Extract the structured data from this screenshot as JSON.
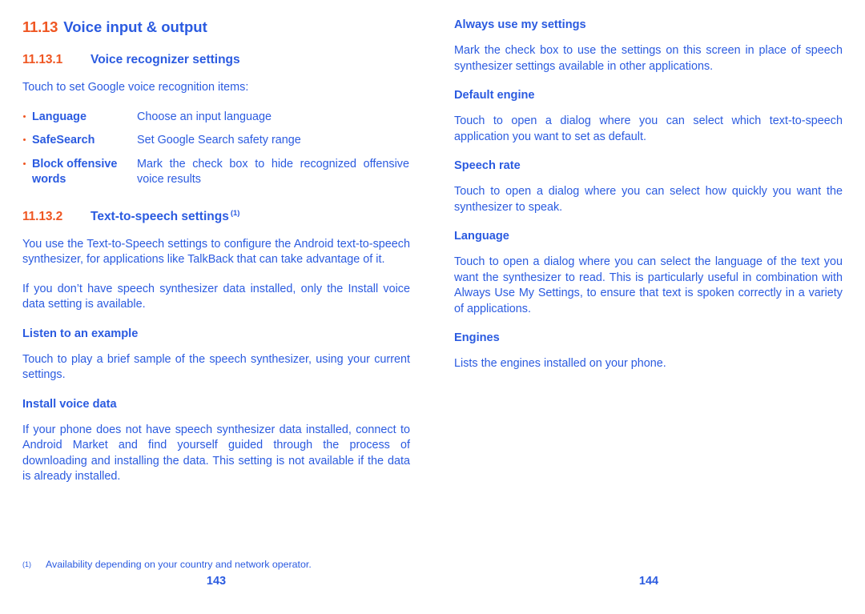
{
  "colors": {
    "accent_orange": "#ef5622",
    "text_blue": "#2b5be0",
    "background": "#ffffff"
  },
  "left_column": {
    "chapter": {
      "number": "11.13",
      "title": "Voice input & output"
    },
    "section_1": {
      "number": "11.13.1",
      "title": "Voice recognizer settings",
      "intro": "Touch to set Google voice recognition items:",
      "items": [
        {
          "term": "Language",
          "desc": "Choose an input language"
        },
        {
          "term": "SafeSearch",
          "desc": "Set Google Search safety range"
        },
        {
          "term": "Block offensive words",
          "desc": "Mark the check box to hide recognized offensive voice results"
        }
      ]
    },
    "section_2": {
      "number": "11.13.2",
      "title": "Text-to-speech settings",
      "footnote_marker": "(1)",
      "paragraphs": [
        "You use the Text-to-Speech settings to configure the Android text-to-speech synthesizer, for applications like TalkBack that can take advantage of it.",
        "If you don’t have speech synthesizer data installed, only the Install voice data setting is available."
      ],
      "subsections": [
        {
          "heading": "Listen to an example",
          "body": "Touch to play a brief sample of the speech synthesizer, using your current settings."
        },
        {
          "heading": "Install voice data",
          "body": "If your phone does not have speech synthesizer data installed, connect to Android Market and find yourself guided through the process of downloading and installing the data. This setting is not available if the data is already installed."
        }
      ]
    }
  },
  "right_column": {
    "subsections": [
      {
        "heading": "Always use my settings",
        "body": "Mark the check box to use the settings on this screen in place of speech synthesizer settings available in other applications."
      },
      {
        "heading": "Default engine",
        "body": "Touch to open a dialog where you can select which text-to-speech application you want to set as default."
      },
      {
        "heading": "Speech rate",
        "body": "Touch to open a dialog where you can select how quickly you want the synthesizer to speak."
      },
      {
        "heading": "Language",
        "body": "Touch to open a dialog where you can select the language of the text you want the synthesizer to read. This is particularly useful in combination with Always Use My Settings, to ensure that text is spoken correctly in a variety of applications."
      },
      {
        "heading": "Engines",
        "body": "Lists the engines installed on your phone."
      }
    ]
  },
  "footnote": {
    "marker": "(1)",
    "text": "Availability depending on your country and network operator."
  },
  "folios": {
    "left": "143",
    "right": "144"
  }
}
